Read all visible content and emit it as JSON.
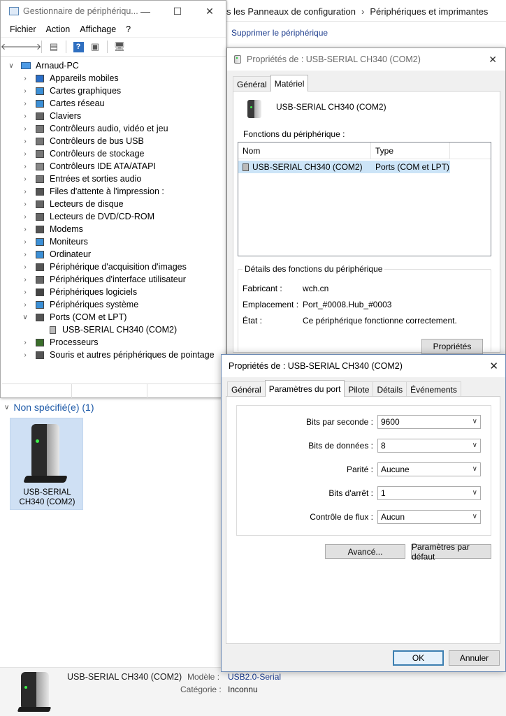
{
  "control_panel": {
    "breadcrumb": [
      "s les Panneaux de configuration",
      "Périphériques et imprimantes"
    ],
    "remove_device": "Supprimer le périphérique",
    "section_title": "Non spécifié(e) (1)",
    "tile_label": "USB-SERIAL CH340 (COM2)",
    "details": {
      "device_name": "USB-SERIAL CH340 (COM2)",
      "model_label": "Modèle :",
      "model_value": "USB2.0-Serial",
      "category_label": "Catégorie :",
      "category_value": "Inconnu"
    }
  },
  "device_manager": {
    "title": "Gestionnaire de périphériqu...",
    "menu": [
      "Fichier",
      "Action",
      "Affichage",
      "?"
    ],
    "root": "Arnaud-PC",
    "categories": [
      {
        "label": "Appareils mobiles",
        "icon": "phone-icon"
      },
      {
        "label": "Cartes graphiques",
        "icon": "display-adapter-icon"
      },
      {
        "label": "Cartes réseau",
        "icon": "network-icon"
      },
      {
        "label": "Claviers",
        "icon": "keyboard-icon"
      },
      {
        "label": "Contrôleurs audio, vidéo et jeu",
        "icon": "audio-icon"
      },
      {
        "label": "Contrôleurs de bus USB",
        "icon": "usb-icon"
      },
      {
        "label": "Contrôleurs de stockage",
        "icon": "storage-icon"
      },
      {
        "label": "Contrôleurs IDE ATA/ATAPI",
        "icon": "ide-icon"
      },
      {
        "label": "Entrées et sorties audio",
        "icon": "speaker-icon"
      },
      {
        "label": "Files d'attente à l'impression :",
        "icon": "printer-icon"
      },
      {
        "label": "Lecteurs de disque",
        "icon": "disk-icon"
      },
      {
        "label": "Lecteurs de DVD/CD-ROM",
        "icon": "dvd-icon"
      },
      {
        "label": "Modems",
        "icon": "modem-icon"
      },
      {
        "label": "Moniteurs",
        "icon": "monitor-icon"
      },
      {
        "label": "Ordinateur",
        "icon": "computer-icon"
      },
      {
        "label": "Périphérique d'acquisition d'images",
        "icon": "camera-icon"
      },
      {
        "label": "Périphériques d'interface utilisateur",
        "icon": "hid-icon"
      },
      {
        "label": "Périphériques logiciels",
        "icon": "software-device-icon"
      },
      {
        "label": "Périphériques système",
        "icon": "system-icon"
      },
      {
        "label": "Ports (COM et LPT)",
        "icon": "port-icon"
      },
      {
        "label": "Processeurs",
        "icon": "cpu-icon"
      },
      {
        "label": "Souris et autres périphériques de pointage",
        "icon": "mouse-icon"
      }
    ],
    "port_child": "USB-SERIAL CH340 (COM2)"
  },
  "props1": {
    "title": "Propriétés de : USB-SERIAL CH340 (COM2)",
    "tabs": [
      "Général",
      "Matériel"
    ],
    "device_name": "USB-SERIAL CH340 (COM2)",
    "functions_label": "Fonctions du périphérique :",
    "columns": [
      "Nom",
      "Type"
    ],
    "row": {
      "name": "USB-SERIAL CH340 (COM2)",
      "type": "Ports (COM et LPT)"
    },
    "details_title": "Détails des fonctions du périphérique",
    "manufacturer_label": "Fabricant :",
    "manufacturer_value": "wch.cn",
    "location_label": "Emplacement :",
    "location_value": "Port_#0008.Hub_#0003",
    "status_label": "État :",
    "status_value": "Ce périphérique fonctionne correctement.",
    "properties_button": "Propriétés"
  },
  "props2": {
    "title": "Propriétés de : USB-SERIAL CH340 (COM2)",
    "tabs": [
      "Général",
      "Paramètres du port",
      "Pilote",
      "Détails",
      "Événements"
    ],
    "fields": [
      {
        "label": "Bits par seconde :",
        "value": "9600"
      },
      {
        "label": "Bits de données :",
        "value": "8"
      },
      {
        "label": "Parité :",
        "value": "Aucune"
      },
      {
        "label": "Bits d'arrêt :",
        "value": "1"
      },
      {
        "label": "Contrôle de flux :",
        "value": "Aucun"
      }
    ],
    "advanced_button": "Avancé...",
    "defaults_button": "Paramètres par défaut",
    "ok_button": "OK",
    "cancel_button": "Annuler"
  }
}
